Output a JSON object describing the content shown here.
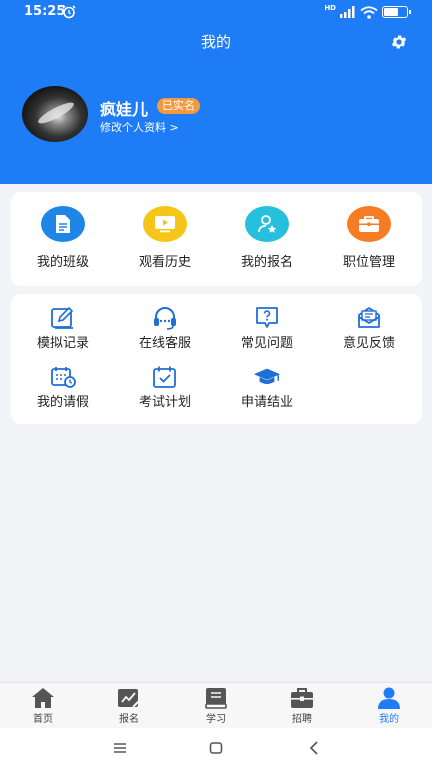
{
  "status_bar": {
    "time": "15:25",
    "network": "HD"
  },
  "header": {
    "title": "我的"
  },
  "profile": {
    "username": "疯娃儿",
    "badge": "已实名",
    "edit_link": "修改个人资料 >"
  },
  "quick_actions": [
    {
      "label": "我的班级",
      "icon": "document-icon",
      "color": "#1f86e8"
    },
    {
      "label": "观看历史",
      "icon": "video-play-icon",
      "color": "#f5c518"
    },
    {
      "label": "我的报名",
      "icon": "user-star-icon",
      "color": "#26c0dc"
    },
    {
      "label": "职位管理",
      "icon": "briefcase-icon",
      "color": "#f57c22"
    }
  ],
  "tools": [
    {
      "label": "模拟记录",
      "icon": "edit-icon"
    },
    {
      "label": "在线客服",
      "icon": "headset-icon"
    },
    {
      "label": "常见问题",
      "icon": "question-icon"
    },
    {
      "label": "意见反馈",
      "icon": "mail-icon"
    },
    {
      "label": "我的请假",
      "icon": "calendar-clock-icon"
    },
    {
      "label": "考试计划",
      "icon": "calendar-check-icon"
    },
    {
      "label": "申请结业",
      "icon": "graduation-cap-icon"
    }
  ],
  "bottom_nav": [
    {
      "label": "首页",
      "icon": "home-icon",
      "active": false
    },
    {
      "label": "报名",
      "icon": "signup-icon",
      "active": false
    },
    {
      "label": "学习",
      "icon": "book-icon",
      "active": false
    },
    {
      "label": "招聘",
      "icon": "briefcase-nav-icon",
      "active": false
    },
    {
      "label": "我的",
      "icon": "person-icon",
      "active": true
    }
  ],
  "colors": {
    "primary": "#1f7cf7",
    "badge": "#f39b3c",
    "tool_icon": "#1f6fd8",
    "nav_inactive": "#555555"
  }
}
